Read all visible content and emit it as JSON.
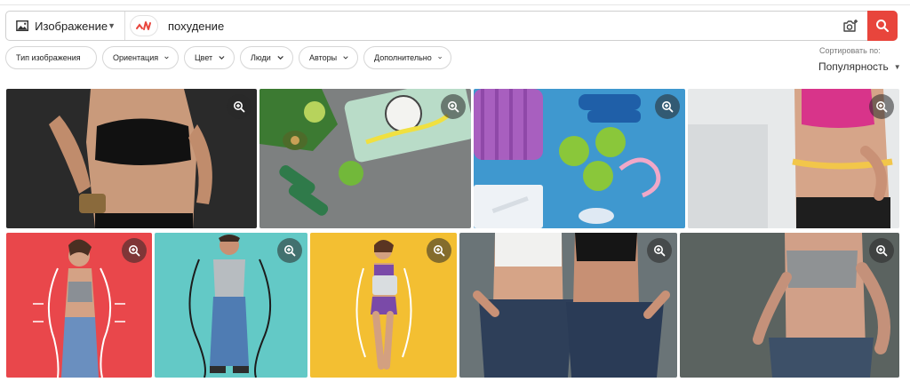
{
  "search": {
    "type_label": "Изображение",
    "query": "похудение",
    "placeholder": ""
  },
  "filters": [
    {
      "label": "Тип изображения"
    },
    {
      "label": "Ориентация"
    },
    {
      "label": "Цвет"
    },
    {
      "label": "Люди"
    },
    {
      "label": "Авторы"
    },
    {
      "label": "Дополнительно"
    }
  ],
  "sort": {
    "label": "Сортировать по:",
    "value": "Популярность"
  },
  "colors": {
    "accent": "#e8453c",
    "tile_red": "#e9474b",
    "tile_teal": "#63c9c6",
    "tile_yellow": "#f3bf32",
    "tile_blue": "#3f98cf",
    "tile_gray": "#5b6360"
  },
  "results": [
    {
      "name": "woman-black-top-belly",
      "icon": "zoom-icon"
    },
    {
      "name": "scale-vegetables-dumbbells",
      "icon": "zoom-icon"
    },
    {
      "name": "apples-dumbbells-blue-mat",
      "icon": "zoom-icon"
    },
    {
      "name": "woman-measuring-waist",
      "icon": "zoom-icon"
    },
    {
      "name": "woman-outline-red-bg",
      "icon": "zoom-icon"
    },
    {
      "name": "man-outline-teal-bg",
      "icon": "zoom-icon"
    },
    {
      "name": "woman-outline-yellow-bg",
      "icon": "zoom-icon"
    },
    {
      "name": "two-women-loose-jeans",
      "icon": "zoom-icon"
    },
    {
      "name": "woman-loose-jeans-gray-bg",
      "icon": "zoom-icon"
    }
  ]
}
